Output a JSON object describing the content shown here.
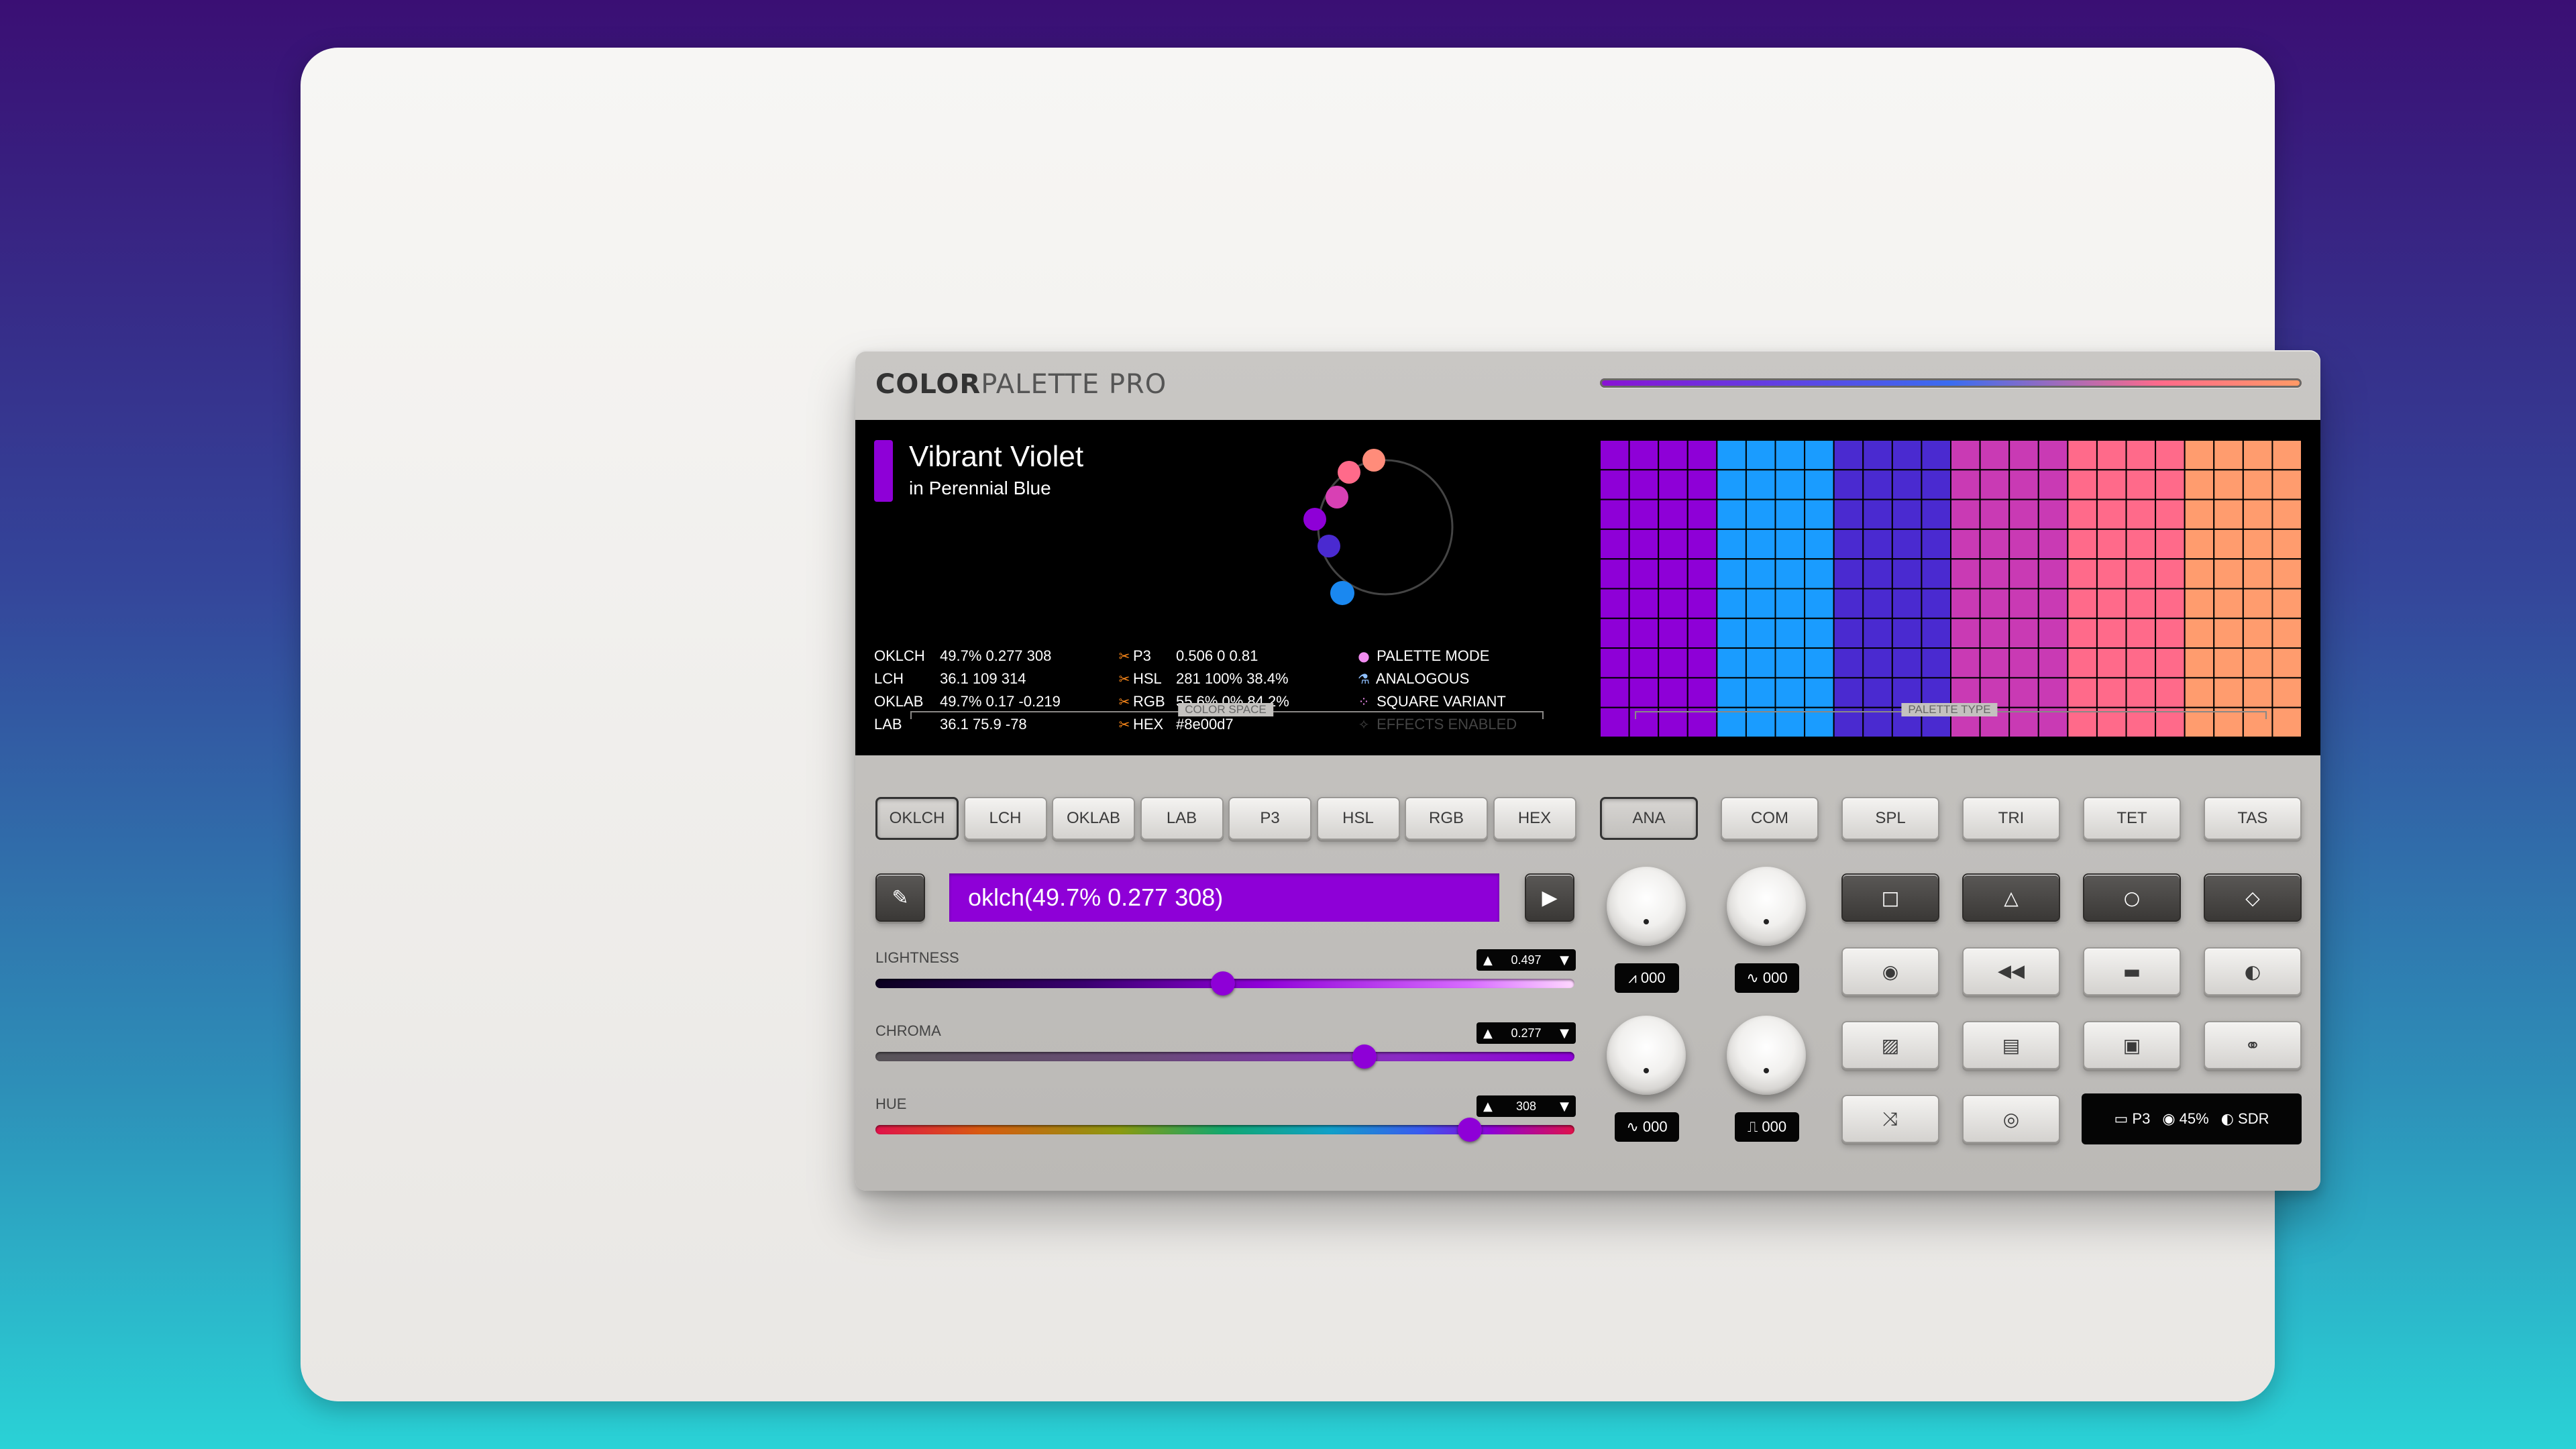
{
  "header": {
    "logo_bold": "COLOR",
    "logo_light": "PALETTE PRO"
  },
  "display": {
    "color_name": "Vibrant Violet",
    "subtitle": "in Perennial Blue",
    "swatch_color": "#8e00d7",
    "values_left": [
      {
        "key": "OKLCH",
        "value": "49.7% 0.277 308"
      },
      {
        "key": "LCH",
        "value": "36.1 109 314"
      },
      {
        "key": "OKLAB",
        "value": "49.7% 0.17 -0.219"
      },
      {
        "key": "LAB",
        "value": "36.1 75.9 -78"
      }
    ],
    "values_mid": [
      {
        "key": "P3",
        "value": "0.506 0 0.81"
      },
      {
        "key": "HSL",
        "value": "281 100% 38.4%"
      },
      {
        "key": "RGB",
        "value": "55.6% 0% 84.2%"
      },
      {
        "key": "HEX",
        "value": "#8e00d7"
      }
    ],
    "status_items": [
      {
        "icon": "palette-icon",
        "label": "PALETTE MODE"
      },
      {
        "icon": "flask-icon",
        "label": "ANALOGOUS"
      },
      {
        "icon": "grid-icon",
        "label": "SQUARE VARIANT"
      },
      {
        "icon": "sparkle-icon",
        "label": "EFFECTS ENABLED"
      }
    ],
    "wheel_points": [
      "#ff8c7a",
      "#ff6a8a",
      "#d840b4",
      "#8e00d7",
      "#4a2ad0",
      "#1a88f0"
    ],
    "palette_columns": [
      "#8e00d7",
      "#1a9cff",
      "#4a2ad0",
      "#c93ab4",
      "#ff6a8a",
      "#ff9c6e"
    ]
  },
  "color_space": {
    "title": "COLOR SPACE",
    "buttons": [
      "OKLCH",
      "LCH",
      "OKLAB",
      "LAB",
      "P3",
      "HSL",
      "RGB",
      "HEX"
    ],
    "selected": "OKLCH"
  },
  "palette_type": {
    "title": "PALETTE TYPE",
    "buttons": [
      "ANA",
      "COM",
      "SPL",
      "TRI",
      "TET",
      "TAS"
    ],
    "selected": "ANA"
  },
  "input": {
    "value": "oklch(49.7% 0.277 308)"
  },
  "sliders": [
    {
      "label": "LIGHTNESS",
      "value": "0.497",
      "fraction": 0.497
    },
    {
      "label": "CHROMA",
      "value": "0.277",
      "fraction": 0.7
    },
    {
      "label": "HUE",
      "value": "308",
      "fraction": 0.85
    }
  ],
  "knobs": [
    {
      "wave": "saw",
      "readout": "000"
    },
    {
      "wave": "sine",
      "readout": "000"
    },
    {
      "wave": "sine",
      "readout": "000"
    },
    {
      "wave": "square",
      "readout": "000"
    }
  ],
  "shape_buttons": [
    "square-icon",
    "triangle-icon",
    "circle-icon",
    "diamond-icon"
  ],
  "tool_buttons": [
    "globe-icon",
    "rewind-icon",
    "card-icon",
    "moon-icon",
    "image-icon",
    "file-icon",
    "clipboard-icon",
    "link-icon",
    "shuffle-icon",
    "disc-icon"
  ],
  "status_bar": {
    "gamut": "P3",
    "vision": "45%",
    "range": "SDR"
  }
}
